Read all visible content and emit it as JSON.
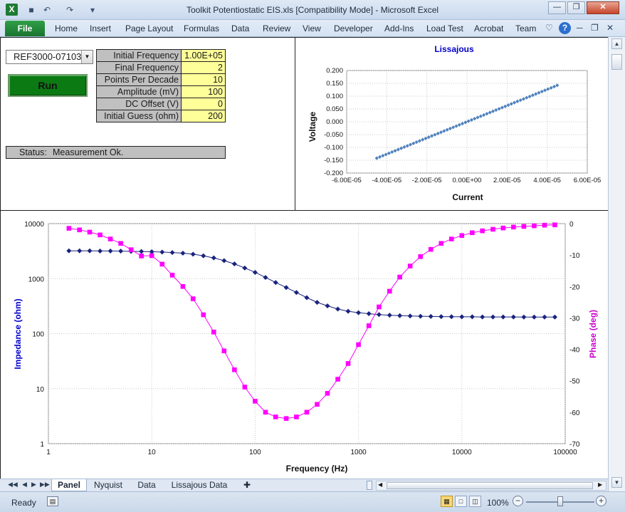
{
  "window": {
    "title": "Toolkit Potentiostatic EIS.xls  [Compatibility Mode]  -  Microsoft Excel",
    "app_icon": "excel-icon",
    "qat_icons": [
      "save-icon",
      "undo-icon",
      "redo-icon",
      "customize-qat-icon"
    ],
    "controls": [
      "minimize-icon",
      "restore-icon",
      "close-icon"
    ]
  },
  "ribbon": {
    "file_label": "File",
    "tabs": [
      "Home",
      "Insert",
      "Page Layout",
      "Formulas",
      "Data",
      "Review",
      "View",
      "Developer",
      "Add-Ins",
      "Load Test",
      "Acrobat",
      "Team"
    ],
    "help": "?"
  },
  "panel": {
    "device_selected": "REF3000-07103",
    "run_label": "Run",
    "params": [
      {
        "label": "Initial Frequency",
        "value": "1.00E+05"
      },
      {
        "label": "Final Frequency",
        "value": "2"
      },
      {
        "label": "Points Per Decade",
        "value": "10"
      },
      {
        "label": "Amplitude (mV)",
        "value": "100"
      },
      {
        "label": "DC Offset (V)",
        "value": "0"
      },
      {
        "label": "Initial Guess (ohm)",
        "value": "200"
      }
    ],
    "status_label": "Status:",
    "status_value": "Measurement Ok."
  },
  "colors": {
    "lissajous_series": "#4f81bd",
    "impedance_series": "#1a237e",
    "phase_series": "#ff00ff",
    "axis_blue": "#0000cc",
    "axis_magenta": "#cc00cc",
    "run_button": "#0b7a13",
    "param_value_bg": "#ffff99",
    "param_label_bg": "#c0c0c0"
  },
  "chart_data": [
    {
      "type": "scatter",
      "title": "Lissajous",
      "xlabel": "Current",
      "ylabel": "Voltage",
      "xlim": [
        -6e-05,
        6e-05
      ],
      "ylim": [
        -0.2,
        0.2
      ],
      "x_ticks": [
        "-6.00E-05",
        "-4.00E-05",
        "-2.00E-05",
        "0.00E+00",
        "2.00E-05",
        "4.00E-05",
        "6.00E-05"
      ],
      "y_ticks": [
        "0.200",
        "0.150",
        "0.100",
        "0.050",
        "0.000",
        "-0.050",
        "-0.100",
        "-0.150",
        "-0.200"
      ],
      "series": [
        {
          "x_start": -4.5e-05,
          "x_end": 4.5e-05,
          "y_start": -0.142,
          "y_end": 0.142,
          "points": 60
        }
      ]
    },
    {
      "type": "line",
      "title": "",
      "xlabel": "Frequency (Hz)",
      "ylabel": "Impedance (ohm)",
      "y2label": "Phase (deg)",
      "x_scale": "log",
      "y_scale": "log",
      "xlim": [
        1,
        100000
      ],
      "ylim": [
        1,
        10000
      ],
      "y2lim": [
        -70,
        0
      ],
      "x_ticks": [
        "1",
        "10",
        "100",
        "1000",
        "10000",
        "100000"
      ],
      "y_ticks": [
        "10000",
        "1000",
        "100",
        "10",
        "1"
      ],
      "y2_ticks": [
        "0",
        "-10",
        "-20",
        "-30",
        "-40",
        "-50",
        "-60",
        "-70"
      ],
      "x": [
        1.58,
        2.0,
        2.51,
        3.16,
        3.98,
        5.01,
        6.31,
        7.94,
        10.0,
        12.6,
        15.8,
        20.0,
        25.1,
        31.6,
        39.8,
        50.1,
        63.1,
        79.4,
        100,
        126,
        158,
        200,
        251,
        316,
        398,
        501,
        631,
        794,
        1000,
        1260,
        1580,
        2000,
        2510,
        3160,
        3980,
        5010,
        6310,
        7940,
        10000,
        12600,
        15800,
        20000,
        25100,
        31600,
        39800,
        50100,
        63100,
        79400
      ],
      "series": [
        {
          "name": "Impedance (ohm)",
          "axis": "left",
          "marker": "diamond",
          "values": [
            3200,
            3200,
            3200,
            3180,
            3170,
            3160,
            3130,
            3110,
            3080,
            3040,
            2980,
            2900,
            2780,
            2600,
            2380,
            2120,
            1850,
            1560,
            1300,
            1050,
            850,
            690,
            560,
            450,
            370,
            320,
            280,
            255,
            240,
            230,
            222,
            216,
            212,
            209,
            207,
            205,
            204,
            203,
            202,
            202,
            201,
            201,
            201,
            201,
            200,
            200,
            200,
            200
          ]
        },
        {
          "name": "Phase (deg)",
          "axis": "right",
          "marker": "square",
          "values": [
            -1.5,
            -2,
            -2.7,
            -3.6,
            -4.9,
            -6.3,
            -8.3,
            -10.3,
            -10.2,
            -12.9,
            -16.4,
            -20,
            -23.9,
            -29,
            -34.5,
            -40.5,
            -46.5,
            -52,
            -56.5,
            -60,
            -61.5,
            -62,
            -61.5,
            -60,
            -57.5,
            -54,
            -49.5,
            -44.5,
            -38.5,
            -32.5,
            -26.5,
            -21.5,
            -17,
            -13.5,
            -10.5,
            -8.2,
            -6.3,
            -4.9,
            -3.8,
            -2.9,
            -2.3,
            -1.8,
            -1.4,
            -1.1,
            -0.9,
            -0.7,
            -0.5,
            -0.4
          ]
        }
      ]
    }
  ],
  "sheet_tabs": [
    "Panel",
    "Nyquist",
    "Data",
    "Lissajous Data"
  ],
  "active_tab": "Panel",
  "statusbar": {
    "ready": "Ready",
    "zoom": "100%"
  }
}
